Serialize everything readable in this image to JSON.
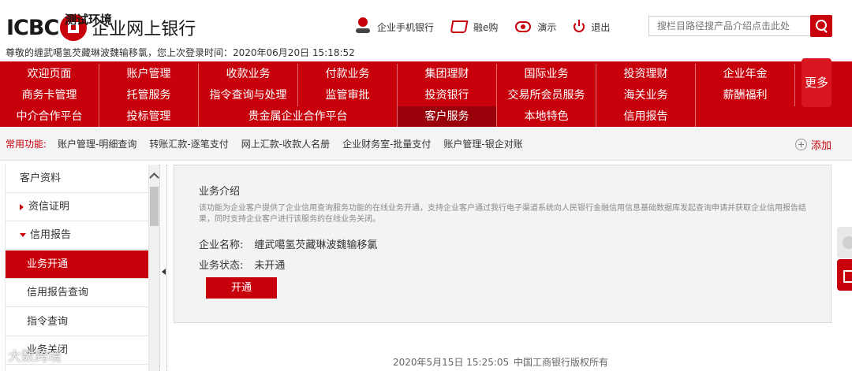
{
  "header": {
    "logo_text": "ICBC",
    "logo_env": "测试环境",
    "site_name": "企业网上银行",
    "welcome": "尊敬的缠武噶氢芡藏琳波魏输移氯，您上次登录时间：2020年06月20日 15:18:52",
    "links": [
      {
        "label": "企业手机银行",
        "icon": "mobile-bank-icon"
      },
      {
        "label": "融e购",
        "icon": "cart-icon"
      },
      {
        "label": "演示",
        "icon": "demo-icon"
      },
      {
        "label": "退出",
        "icon": "power-icon"
      }
    ],
    "search": {
      "placeholder": "搜栏目路径搜产品介绍点击此处",
      "icon": "search-icon"
    }
  },
  "nav": {
    "row1": [
      "欢迎页面",
      "账户管理",
      "收款业务",
      "付款业务",
      "集团理财",
      "国际业务",
      "投资理财",
      "企业年金"
    ],
    "row2": [
      "商务卡管理",
      "托管服务",
      "指令查询与处理",
      "监管审批",
      "投资银行",
      "交易所会员服务",
      "海关业务",
      "薪酬福利"
    ],
    "row3": [
      "中介合作平台",
      "投标管理",
      "贵金属企业合作平台",
      "客户服务",
      "本地特色",
      "信用报告"
    ],
    "more": "更多",
    "active": "客户服务"
  },
  "quick": {
    "label": "常用功能:",
    "links": [
      "账户管理-明细查询",
      "转账汇款-逐笔支付",
      "网上汇款-收款人名册",
      "企业财务室-批量支付",
      "账户管理-银企对账"
    ],
    "add": "添加"
  },
  "sidebar": {
    "items": [
      {
        "label": "客户资料",
        "type": "head"
      },
      {
        "label": "资信证明",
        "type": "parent"
      },
      {
        "label": "信用报告",
        "type": "parent"
      },
      {
        "label": "业务开通",
        "type": "child"
      },
      {
        "label": "信用报告查询",
        "type": "child"
      },
      {
        "label": "指令查询",
        "type": "child"
      },
      {
        "label": "业务关闭",
        "type": "child"
      }
    ]
  },
  "panel": {
    "title": "业务介绍",
    "description": "该功能为企业客户提供了企业信用查询服务功能的在线业务开通，支持企业客户通过我行电子渠道系统向人民银行金融信用信息基础数据库发起查询申请并获取企业信用报告结果，同时支持企业客户进行该服务的在线业务关闭。",
    "company_label": "企业名称:",
    "company_value": "缠武噶氢芡藏琳波魏输移氯",
    "status_label": "业务状态:",
    "status_value": "未开通",
    "button": "开通"
  },
  "footer": {
    "date": "2020年5月15日 15:25:05",
    "copyright": "中国工商银行版权所有"
  },
  "watermark": "大数跨境",
  "colors": {
    "brand": "#c7000b",
    "active_nav": "#9a000a"
  }
}
